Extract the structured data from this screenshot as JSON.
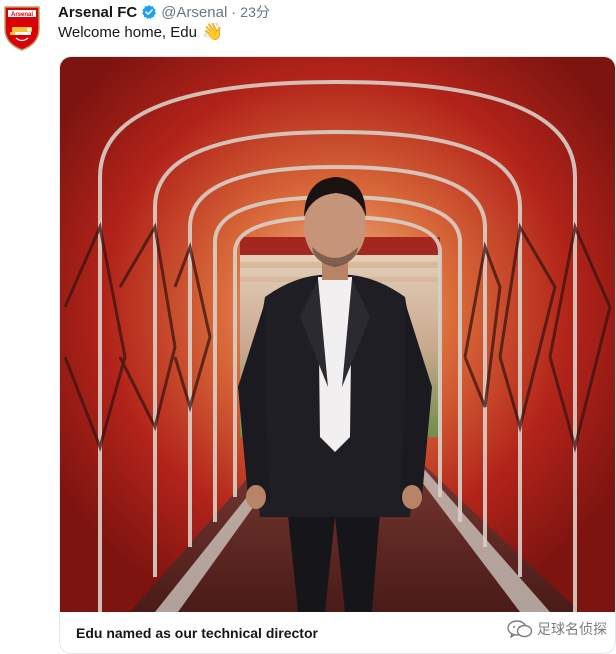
{
  "tweet": {
    "author_name": "Arsenal FC",
    "handle": "@Arsenal",
    "separator": "·",
    "time": "23分",
    "text": "Welcome home, Edu",
    "emoji": "👋",
    "avatar_icon": "arsenal-crest",
    "verified_icon": "verified-badge"
  },
  "card": {
    "title": "Edu named as our technical director",
    "image_icon": "photo-edu-in-stadium-tunnel"
  },
  "watermark": {
    "text": "足球名侦探",
    "icon": "wechat-icon"
  },
  "colors": {
    "text_primary": "#14171a",
    "text_secondary": "#657786",
    "verified_blue": "#1da1f2",
    "arsenal_red": "#db0007",
    "tunnel_red": "#c0281c"
  }
}
